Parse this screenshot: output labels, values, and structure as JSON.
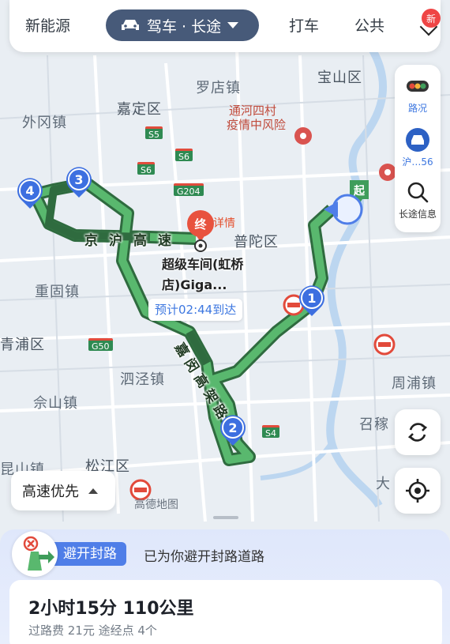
{
  "top_bar": {
    "tab_new_energy": "新能源",
    "mode_label": "驾车 · 长途",
    "tab_taxi": "打车",
    "tab_public": "公共",
    "badge": "新"
  },
  "side_panel": {
    "traffic_label": "路况",
    "plate_label": "沪…56",
    "long_trip_info": "长途信息"
  },
  "map": {
    "places": [
      "宝山区",
      "罗店镇",
      "嘉定区",
      "外冈镇",
      "普陀区",
      "重固镇",
      "青浦区",
      "泗泾镇",
      "佘山镇",
      "周浦镇",
      "召稼",
      "松江区",
      "昆山镇",
      "大"
    ],
    "warning_place": "通河四村",
    "warning_text": "疫情中风险",
    "road_name_1": "京沪高速",
    "road_name_2": "嘉闵高架路",
    "shields": [
      "S5",
      "S6",
      "S6",
      "G204",
      "G50",
      "S4"
    ],
    "end_marker": "终",
    "detail_label": "详情",
    "destination": "超级车间(虹桥店)Giga...",
    "eta": "预计02:44到达",
    "start_marker": "起",
    "waypoints": [
      "1",
      "2",
      "3",
      "4"
    ],
    "watermark": "高德地图"
  },
  "preference_button": "高速优先",
  "notice": {
    "tag": "避开封路",
    "text": "已为你避开封路道路"
  },
  "route_summary": {
    "duration_distance": "2小时15分  110公里",
    "toll_waypoints": "过路费 21元   途经点 4个"
  },
  "colors": {
    "route": "#3f9d5b",
    "accent_blue": "#3d77e0",
    "pill": "#475a79",
    "alert_red": "#e24a3b"
  }
}
